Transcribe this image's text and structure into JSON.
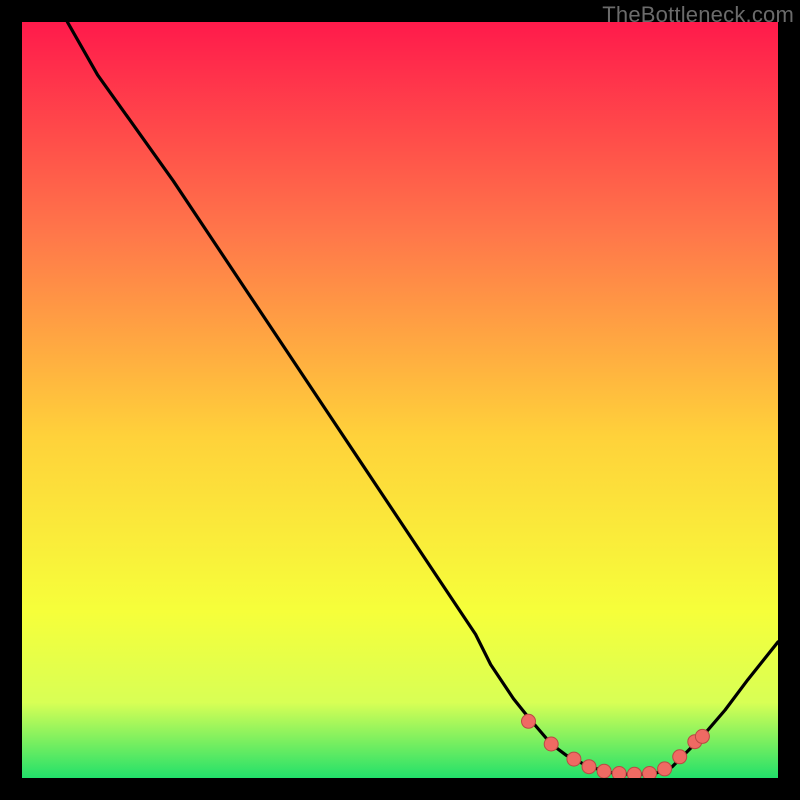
{
  "watermark": "TheBottleneck.com",
  "colors": {
    "gradient_top": "#ff1a4b",
    "gradient_mid_upper": "#ff774a",
    "gradient_mid": "#ffd23a",
    "gradient_mid_lower": "#f6ff3a",
    "gradient_lower": "#d8ff55",
    "gradient_bottom": "#22e06a",
    "curve": "#000000",
    "marker_fill": "#ef6a63",
    "marker_stroke": "#b94a44"
  },
  "chart_data": {
    "type": "line",
    "title": "",
    "xlabel": "",
    "ylabel": "",
    "xlim": [
      0,
      100
    ],
    "ylim": [
      0,
      100
    ],
    "series": [
      {
        "name": "bottleneck-curve",
        "x": [
          6,
          10,
          15,
          20,
          25,
          30,
          35,
          40,
          45,
          50,
          55,
          60,
          62,
          65,
          67,
          70,
          72,
          75,
          78,
          80,
          82,
          84,
          86,
          88,
          90,
          93,
          96,
          100
        ],
        "y": [
          100,
          93,
          86,
          79,
          71.5,
          64,
          56.5,
          49,
          41.5,
          34,
          26.5,
          19,
          15,
          10.5,
          8,
          4.5,
          3,
          1.5,
          0.7,
          0.5,
          0.5,
          0.7,
          1.5,
          3.5,
          5.5,
          9,
          13,
          18
        ]
      }
    ],
    "markers": {
      "name": "highlight-points",
      "x": [
        67,
        70,
        73,
        75,
        77,
        79,
        81,
        83,
        85,
        87,
        89,
        90
      ],
      "y": [
        7.5,
        4.5,
        2.5,
        1.5,
        0.9,
        0.6,
        0.5,
        0.6,
        1.2,
        2.8,
        4.8,
        5.5
      ]
    }
  }
}
